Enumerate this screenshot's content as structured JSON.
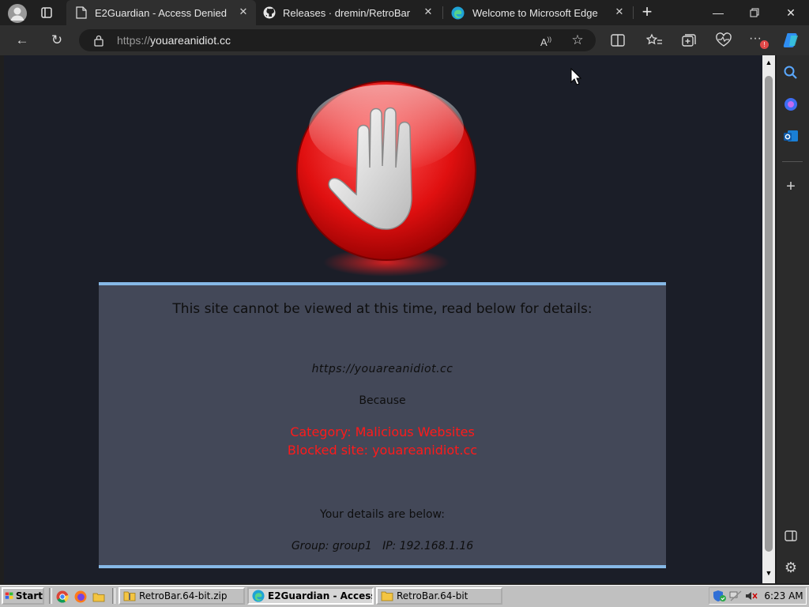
{
  "browser": {
    "tabs": [
      {
        "title": "E2Guardian - Access Denied",
        "icon": "page-icon",
        "active": true
      },
      {
        "title": "Releases · dremin/RetroBar",
        "icon": "github-icon",
        "active": false
      },
      {
        "title": "Welcome to Microsoft Edge",
        "icon": "edge-icon",
        "active": false
      }
    ],
    "address": {
      "scheme": "https://",
      "host": "youareanidiot.cc"
    }
  },
  "page": {
    "heading": "This site cannot be viewed at this time, read below for details:",
    "blocked_url": "https://youareanidiot.cc",
    "because_label": "Because",
    "category_line": "Category: Malicious Websites",
    "blocked_line": "Blocked site: youareanidiot.cc",
    "details_heading": "Your details are below:",
    "details_line": "Group: group1   IP: 192.168.1.16"
  },
  "taskbar": {
    "start_label": "Start",
    "buttons": [
      {
        "label": "RetroBar.64-bit.zip",
        "icon": "zip-folder-icon",
        "pressed": false
      },
      {
        "label": "E2Guardian - Access...",
        "icon": "edge-icon",
        "pressed": true
      },
      {
        "label": "RetroBar.64-bit",
        "icon": "folder-icon",
        "pressed": false
      }
    ],
    "clock": "6:23 AM"
  },
  "colors": {
    "blocked_text": "#ff1a1a",
    "panel_border": "#86b8e6",
    "panel_bg": "#434858",
    "page_bg": "#1b1e28"
  }
}
